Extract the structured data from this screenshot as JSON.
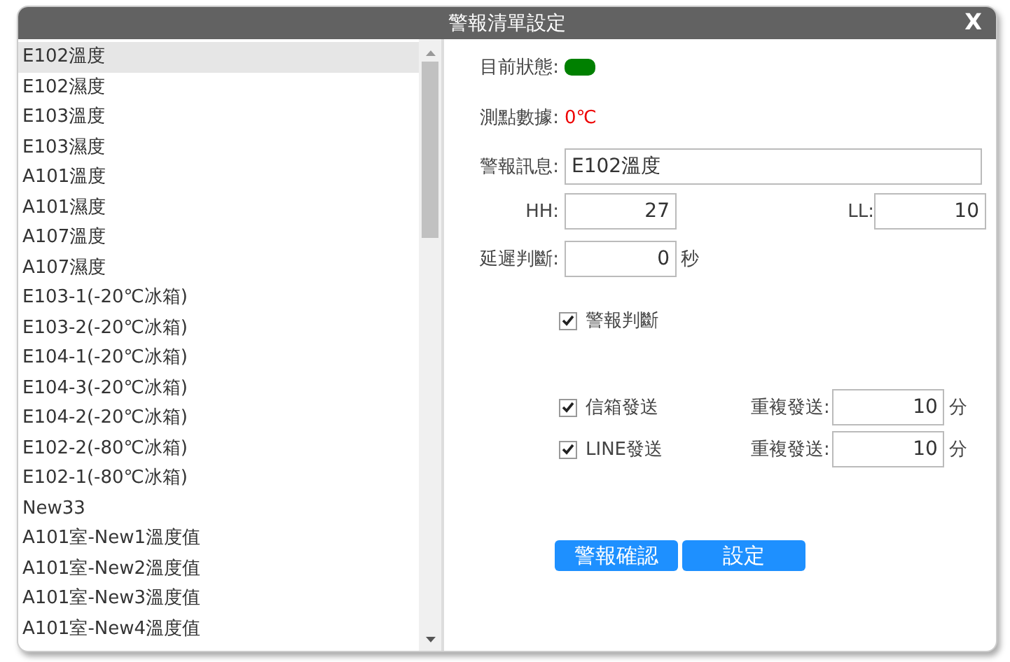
{
  "window": {
    "title": "警報清單設定",
    "close": "X"
  },
  "list": {
    "items": [
      {
        "label": "E102溫度",
        "selected": true
      },
      {
        "label": "E102濕度",
        "selected": false
      },
      {
        "label": "E103溫度",
        "selected": false
      },
      {
        "label": "E103濕度",
        "selected": false
      },
      {
        "label": "A101溫度",
        "selected": false
      },
      {
        "label": "A101濕度",
        "selected": false
      },
      {
        "label": "A107溫度",
        "selected": false
      },
      {
        "label": "A107濕度",
        "selected": false
      },
      {
        "label": "E103-1(-20℃冰箱)",
        "selected": false
      },
      {
        "label": "E103-2(-20℃冰箱)",
        "selected": false
      },
      {
        "label": "E104-1(-20℃冰箱)",
        "selected": false
      },
      {
        "label": "E104-3(-20℃冰箱)",
        "selected": false
      },
      {
        "label": "E104-2(-20℃冰箱)",
        "selected": false
      },
      {
        "label": "E102-2(-80℃冰箱)",
        "selected": false
      },
      {
        "label": "E102-1(-80℃冰箱)",
        "selected": false
      },
      {
        "label": "New33",
        "selected": false
      },
      {
        "label": "A101室-New1溫度值",
        "selected": false
      },
      {
        "label": "A101室-New2溫度值",
        "selected": false
      },
      {
        "label": "A101室-New3溫度值",
        "selected": false
      },
      {
        "label": "A101室-New4溫度值",
        "selected": false
      }
    ]
  },
  "form": {
    "status": {
      "label": "目前狀態:",
      "color": "#008000"
    },
    "data": {
      "label": "測點數據:",
      "value": "0℃"
    },
    "message": {
      "label": "警報訊息:",
      "value": "E102溫度"
    },
    "hh": {
      "label": "HH:",
      "value": "27"
    },
    "ll": {
      "label": "LL:",
      "value": "10"
    },
    "delay": {
      "label": "延遲判斷:",
      "value": "0",
      "unit": "秒"
    },
    "alarm_check": {
      "label": "警報判斷",
      "checked": true
    },
    "senders": [
      {
        "label": "信箱發送",
        "checked": true,
        "repeat_label": "重複發送:",
        "repeat_value": "10",
        "unit": "分"
      },
      {
        "label": "LINE發送",
        "checked": true,
        "repeat_label": "重複發送:",
        "repeat_value": "10",
        "unit": "分"
      }
    ]
  },
  "buttons": [
    "警報確認",
    "設定"
  ]
}
